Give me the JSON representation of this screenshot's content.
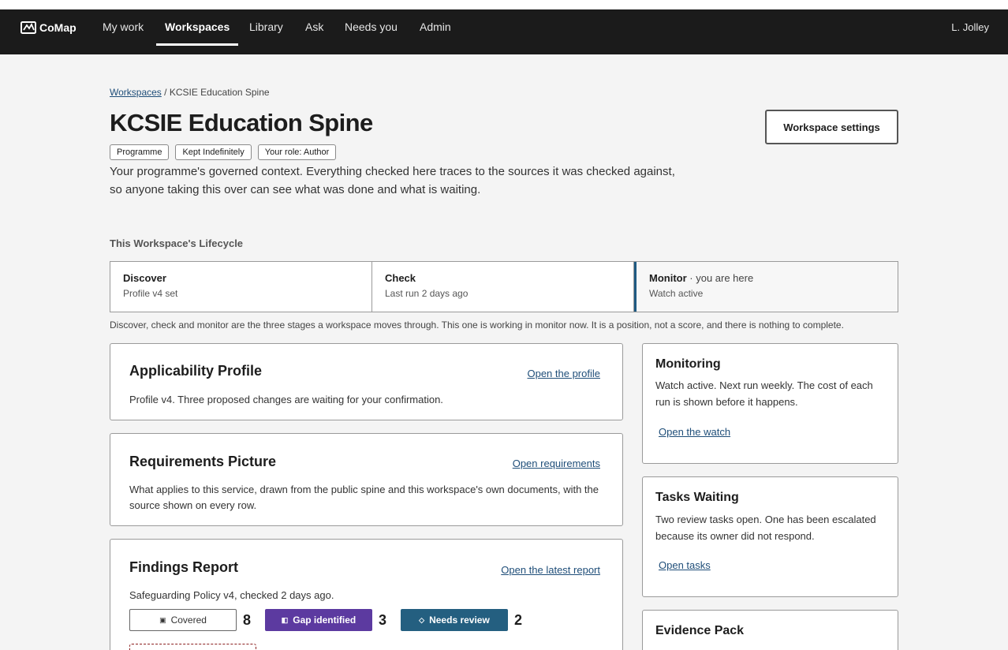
{
  "app": {
    "name": "CoMap",
    "user": "L. Jolley"
  },
  "nav": [
    {
      "label": "My work",
      "active": false
    },
    {
      "label": "Workspaces",
      "active": true
    },
    {
      "label": "Library",
      "active": false
    },
    {
      "label": "Ask",
      "active": false
    },
    {
      "label": "Needs you",
      "active": false
    },
    {
      "label": "Admin",
      "active": false
    }
  ],
  "breadcrumb": {
    "root": "Workspaces",
    "current": "/ KCSIE Education Spine"
  },
  "page": {
    "title": "KCSIE Education Spine",
    "settings_label": "Workspace settings",
    "tags": [
      "Programme",
      "Kept Indefinitely",
      "Your role: Author"
    ],
    "intro": "Your programme's governed context. Everything checked here traces to the sources it was checked against, so anyone taking this over can see what was done and what is waiting."
  },
  "lifecycle": {
    "label": "This Workspace's Lifecycle",
    "stages": [
      {
        "name": "Discover",
        "here": "",
        "sub": "Profile v4 set"
      },
      {
        "name": "Check",
        "here": "",
        "sub": "Last run 2 days ago"
      },
      {
        "name": "Monitor",
        "here": " · you are here",
        "sub": "Watch active"
      }
    ],
    "note": "Discover, check and monitor are the three stages a workspace moves through. This one is working in monitor now. It is a position, not a score, and there is nothing to complete."
  },
  "cards": {
    "profile": {
      "title": "Applicability Profile",
      "link": "Open the profile",
      "body": "Profile v4. Three proposed changes are waiting for your confirmation."
    },
    "requirements": {
      "title": "Requirements Picture",
      "link": "Open requirements",
      "body": "What applies to this service, drawn from the public spine and this workspace's own documents, with the source shown on every row."
    },
    "findings": {
      "title": "Findings Report",
      "link": "Open the latest report",
      "body": "Safeguarding Policy v4, checked 2 days ago.",
      "counts": [
        {
          "label": "Covered",
          "icon": "▣",
          "value": "8"
        },
        {
          "label": "Gap identified",
          "icon": "◧",
          "value": "3"
        },
        {
          "label": "Needs review",
          "icon": "◇",
          "value": "2"
        }
      ]
    }
  },
  "side": {
    "monitoring": {
      "title": "Monitoring",
      "body": "Watch active. Next run weekly. The cost of each run is shown before it happens.",
      "link": "Open the watch"
    },
    "tasks": {
      "title": "Tasks Waiting",
      "body": "Two review tasks open. One has been escalated because its owner did not respond.",
      "link": "Open tasks"
    },
    "evidence": {
      "title": "Evidence Pack"
    }
  }
}
